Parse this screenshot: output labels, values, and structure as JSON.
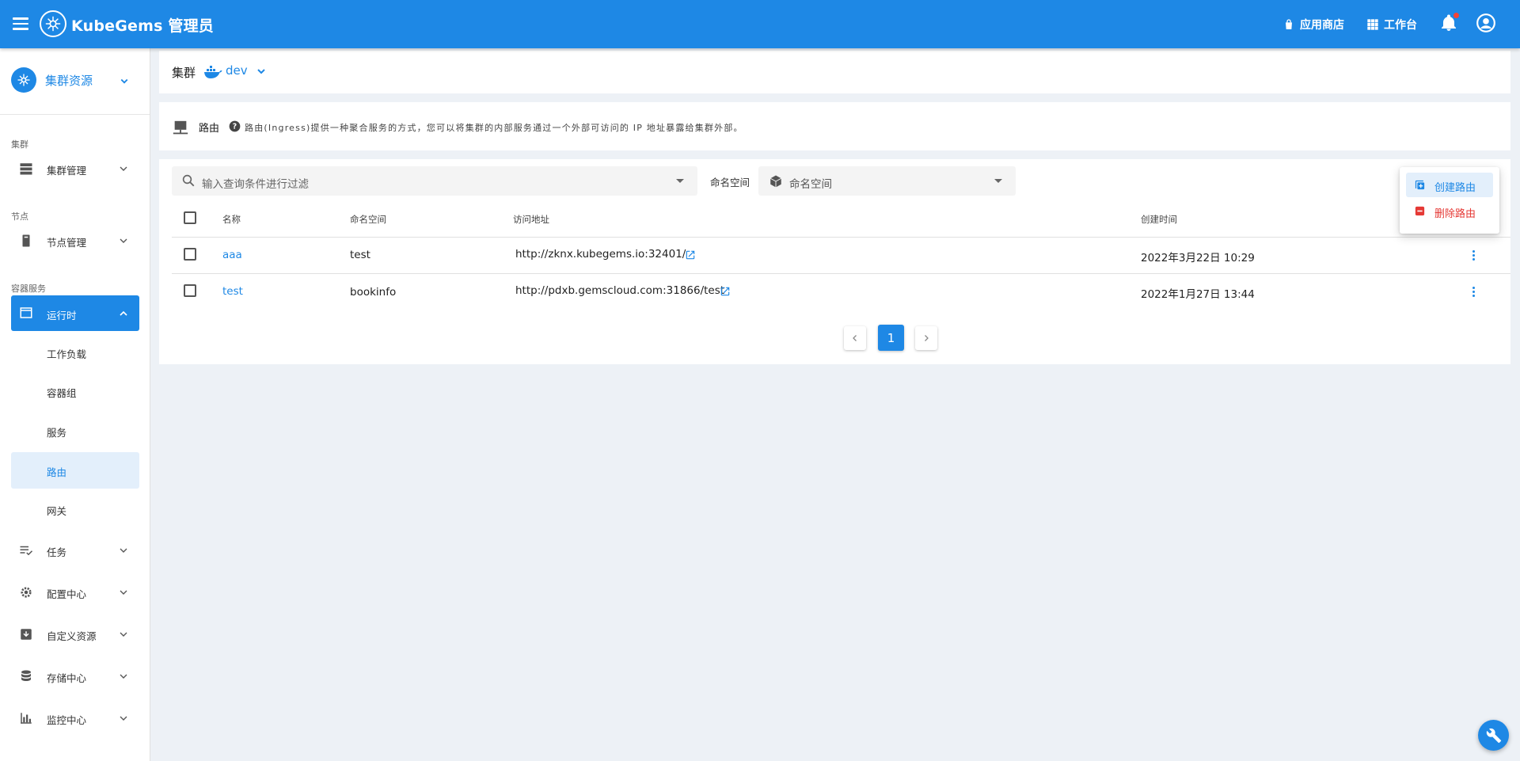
{
  "header": {
    "brand": "KubeGems 管理员",
    "app_store": "应用商店",
    "workbench": "工作台"
  },
  "sidebar": {
    "cluster_title": "集群资源",
    "sections": {
      "cluster": "集群",
      "node": "节点",
      "container": "容器服务"
    },
    "items": {
      "cluster_manage": "集群管理",
      "node_manage": "节点管理",
      "runtime": "运行时",
      "workload": "工作负载",
      "pod": "容器组",
      "service": "服务",
      "ingress": "路由",
      "gateway": "网关",
      "job": "任务",
      "config": "配置中心",
      "crd": "自定义资源",
      "storage": "存储中心",
      "monitor": "监控中心"
    }
  },
  "cluster_bar": {
    "label": "集群",
    "env": "dev"
  },
  "info": {
    "title": "路由",
    "description": "路由(Ingress)提供一种聚合服务的方式，您可以将集群的内部服务通过一个外部可访问的 IP 地址暴露给集群外部。"
  },
  "filters": {
    "search_placeholder": "输入查询条件进行过滤",
    "namespace_label": "命名空间",
    "namespace_placeholder": "命名空间"
  },
  "table": {
    "columns": [
      "名称",
      "命名空间",
      "访问地址",
      "创建时间"
    ],
    "rows": [
      {
        "name": "aaa",
        "namespace": "test",
        "address": "http://zknx.kubegems.io:32401/",
        "created": "2022年3月22日 10:29"
      },
      {
        "name": "test",
        "namespace": "bookinfo",
        "address": "http://pdxb.gemscloud.com:31866/test",
        "created": "2022年1月27日 13:44"
      }
    ]
  },
  "pagination": {
    "current": "1"
  },
  "menu": {
    "create": "创建路由",
    "delete": "删除路由"
  },
  "colors": {
    "primary": "#1e88e5",
    "danger": "#e53935",
    "background": "#edf1f6"
  }
}
